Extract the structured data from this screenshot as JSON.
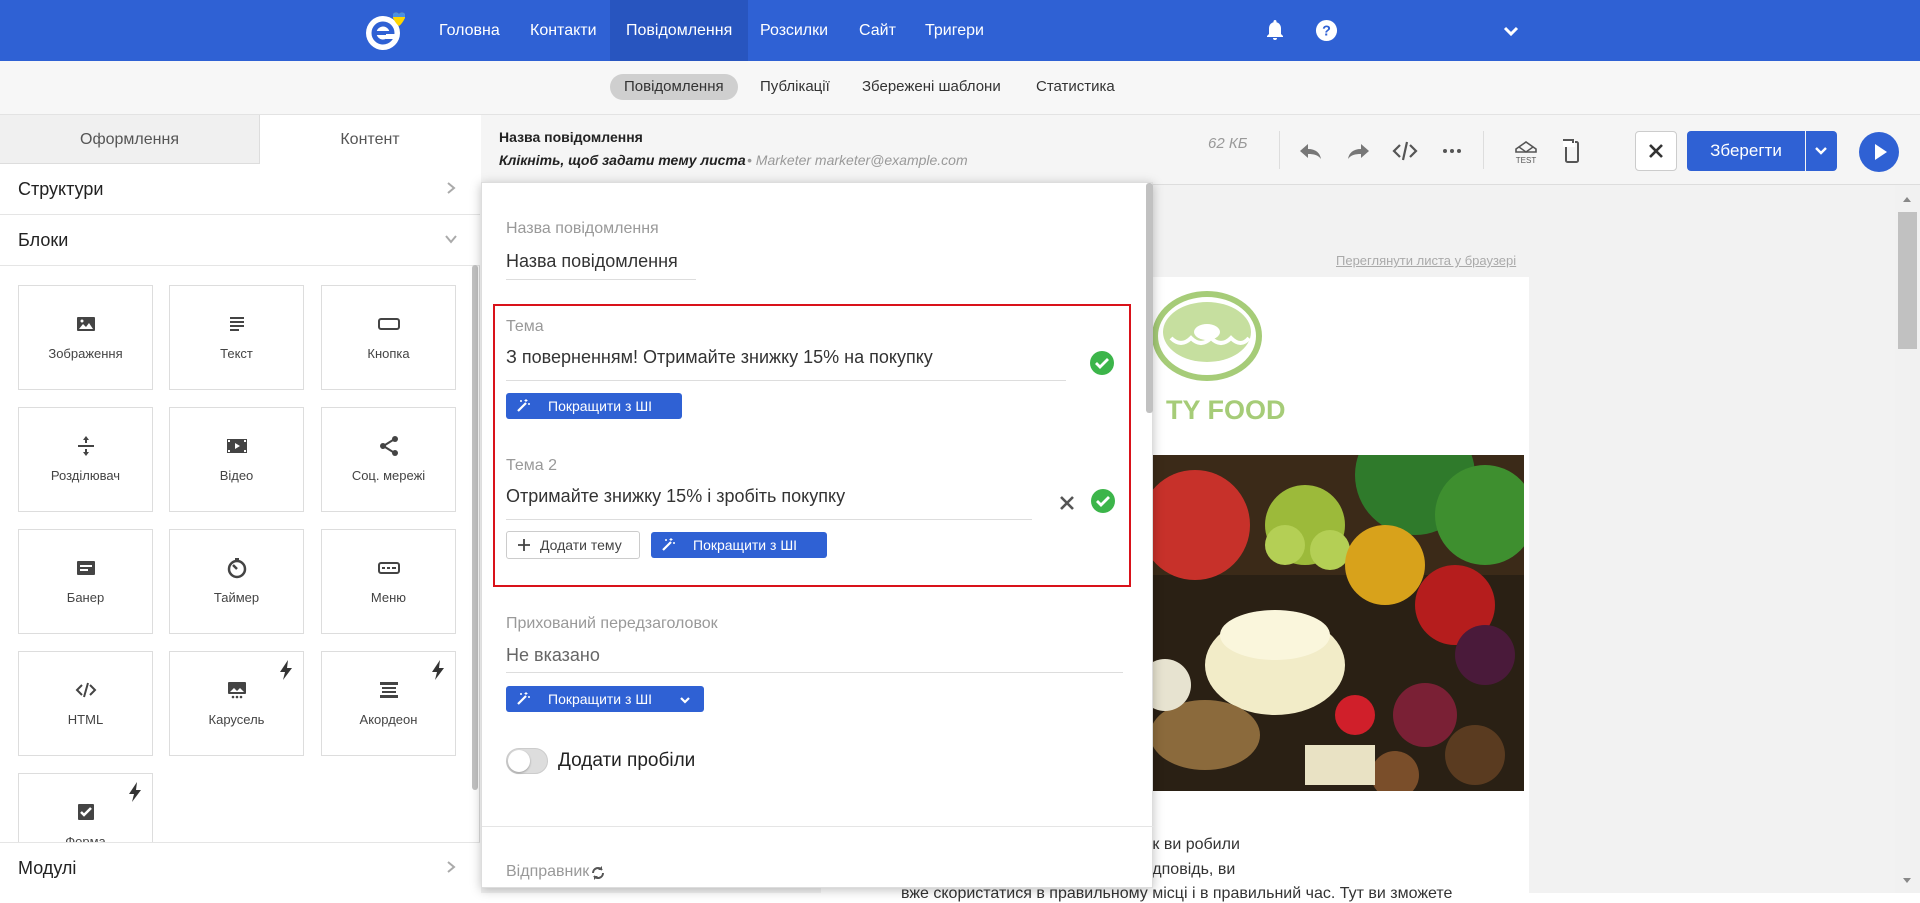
{
  "nav": {
    "items": [
      "Головна",
      "Контакти",
      "Повідомлення",
      "Розсилки",
      "Сайт",
      "Тригери"
    ],
    "active": "Повідомлення",
    "icons": [
      "logo-icon",
      "bell-icon",
      "help-icon",
      "chevron-down-icon"
    ]
  },
  "subnav": {
    "items": [
      "Повідомлення",
      "Публікації",
      "Збережені шаблони",
      "Статистика"
    ],
    "active": "Повідомлення"
  },
  "left": {
    "tabs": [
      "Оформлення",
      "Контент"
    ],
    "active_tab": "Контент",
    "sections": {
      "structures": "Структури",
      "blocks": "Блоки",
      "modules": "Модулі"
    },
    "blocks": [
      {
        "label": "Зображення",
        "icon": "image-icon"
      },
      {
        "label": "Текст",
        "icon": "text-icon"
      },
      {
        "label": "Кнопка",
        "icon": "button-icon"
      },
      {
        "label": "Розділювач",
        "icon": "divider-icon"
      },
      {
        "label": "Відео",
        "icon": "video-icon"
      },
      {
        "label": "Соц. мережі",
        "icon": "share-icon"
      },
      {
        "label": "Банер",
        "icon": "banner-icon"
      },
      {
        "label": "Таймер",
        "icon": "timer-icon"
      },
      {
        "label": "Меню",
        "icon": "menu-icon"
      },
      {
        "label": "HTML",
        "icon": "code-icon"
      },
      {
        "label": "Карусель",
        "icon": "carousel-icon"
      },
      {
        "label": "Акордеон",
        "icon": "accordion-icon"
      },
      {
        "label": "Форма",
        "icon": "form-icon"
      }
    ]
  },
  "editor": {
    "message_name": "Назва повідомлення",
    "subject_hint": "Клікніть, щоб задати тему листа",
    "sender": "Marketer marketer@example.com",
    "size": "62 КБ",
    "save_label": "Зберегти"
  },
  "preview": {
    "view_in_browser": "Переглянути листа у браузері",
    "brand": "TY FOOD",
    "text_line1": "слугами доставки смачної їжі? Як ви робили",
    "text_line2": "рез сайт? Якою б не була ваш відповідь, ви",
    "text_line3": "вже скористатися в правильному місці і в правильний час. Тут ви зможете"
  },
  "popup": {
    "name_label": "Назва повідомлення",
    "name_value": "Назва повідомлення",
    "subject_label": "Тема",
    "subject_value": "З поверненням! Отримайте знижку 15% на покупку",
    "subject2_label": "Тема 2",
    "subject2_value": "Отримайте знижку 15% і зробіть покупку",
    "ai_button": "Покращити з ШІ",
    "add_topic": "Додати тему",
    "preheader_label": "Прихований передзаголовок",
    "preheader_value": "Не вказано",
    "spaces_label": "Додати пробіли",
    "spaces_on": false,
    "sender_label": "Відправник"
  },
  "colors": {
    "brand_blue": "#2f61d4",
    "success": "#3cb54a",
    "highlight": "#d9121a"
  }
}
